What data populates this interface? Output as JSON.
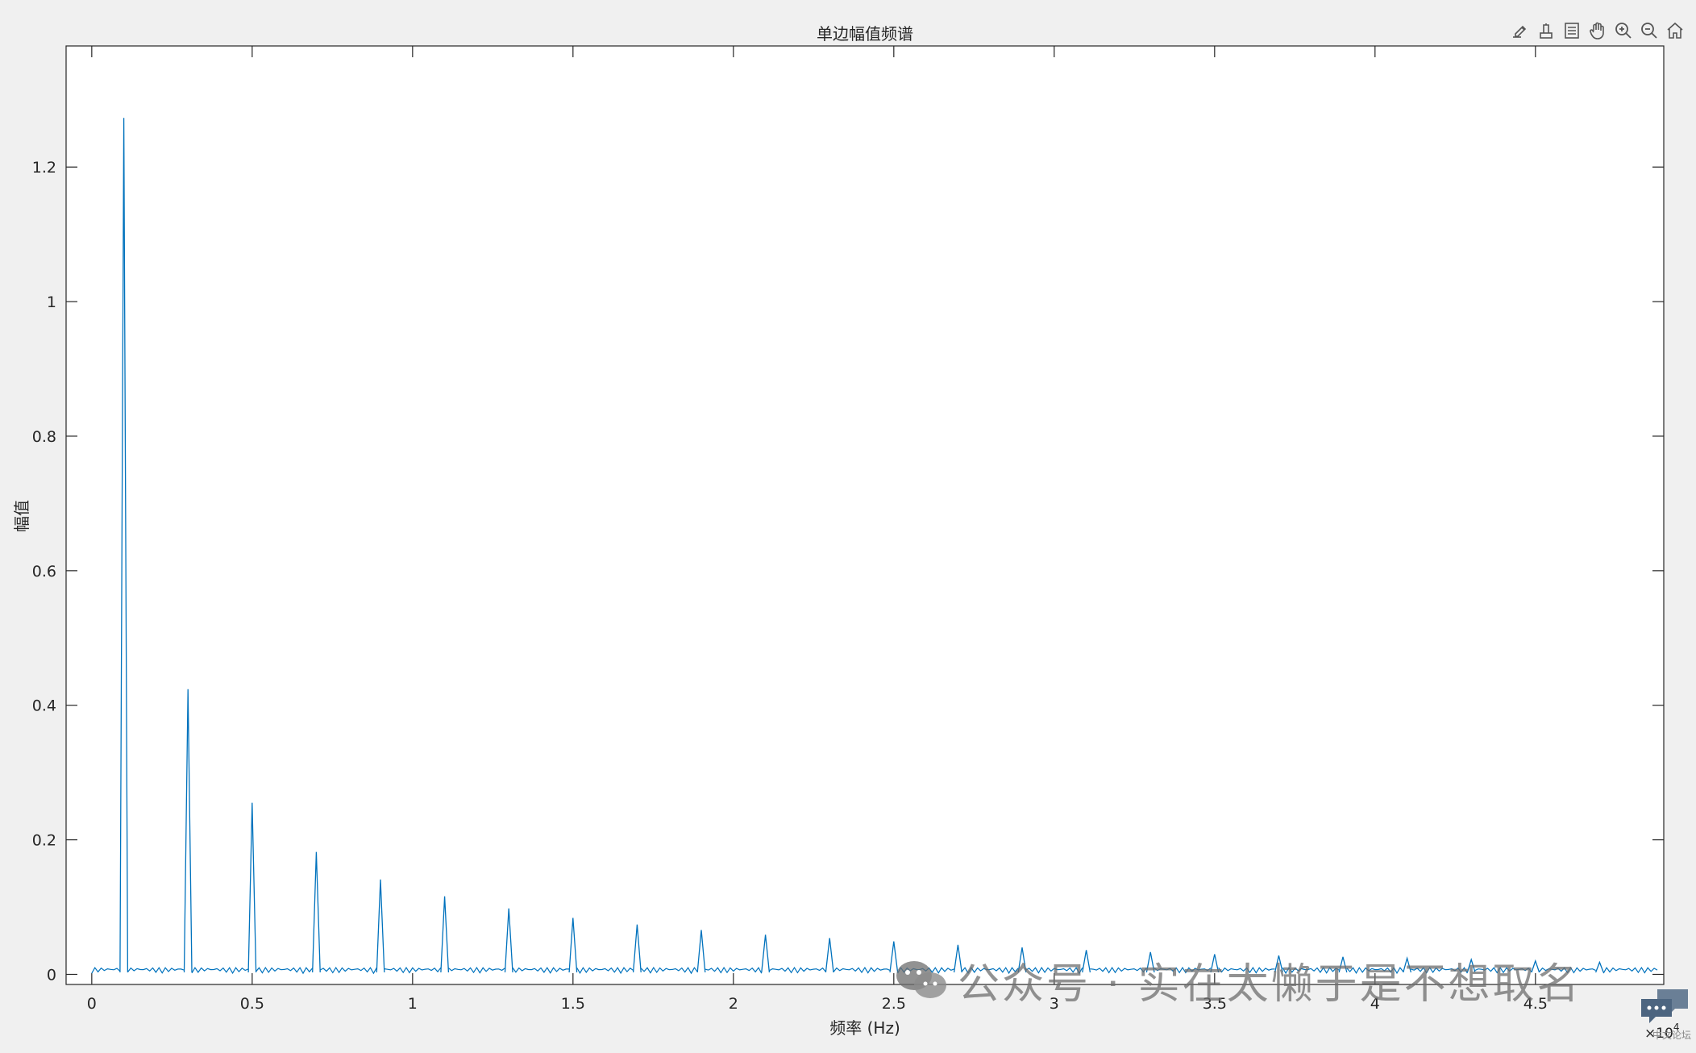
{
  "toolbar": {
    "icons": [
      "brush-edit-icon",
      "datatip-icon",
      "legend-icon",
      "pan-hand-icon",
      "zoom-in-icon",
      "zoom-out-icon",
      "home-icon"
    ]
  },
  "watermark": {
    "text": "公众号 · 实在太懒于是不想取名",
    "icon": "wechat-icon"
  },
  "corner_badge": {
    "text": "中文论坛",
    "icon": "chat-bubble-icon"
  },
  "colors": {
    "line": "#0072BD",
    "axes_bg": "#ffffff",
    "figure_bg": "#f0f0f0",
    "axis": "#262626"
  },
  "chart_data": {
    "type": "line",
    "title": "单边幅值频谱",
    "xlabel": "频率 (Hz)",
    "ylabel": "幅值",
    "x_exponent_label": "×10",
    "x_exponent_power": "4",
    "xlim": [
      -800,
      49000
    ],
    "ylim": [
      -0.015,
      1.38
    ],
    "x_ticks": [
      0,
      5000,
      10000,
      15000,
      20000,
      25000,
      30000,
      35000,
      40000,
      45000
    ],
    "x_tick_labels": [
      "0",
      "0.5",
      "1",
      "1.5",
      "2",
      "2.5",
      "3",
      "3.5",
      "4",
      "4.5"
    ],
    "y_ticks": [
      0,
      0.2,
      0.4,
      0.6,
      0.8,
      1.0,
      1.2
    ],
    "y_tick_labels": [
      "0",
      "0.2",
      "0.4",
      "0.6",
      "0.8",
      "1",
      "1.2"
    ],
    "grid": false,
    "series": [
      {
        "harmonic_frequencies": [
          1000,
          3000,
          5000,
          7000,
          9000,
          11000,
          13000,
          15000,
          17000,
          19000,
          21000,
          23000,
          25000,
          27000,
          29000,
          31000,
          33000,
          35000,
          37000,
          39000,
          41000,
          43000,
          45000,
          47000
        ],
        "harmonic_peaks": [
          1.273,
          0.424,
          0.255,
          0.182,
          0.141,
          0.116,
          0.098,
          0.084,
          0.074,
          0.066,
          0.059,
          0.054,
          0.049,
          0.044,
          0.04,
          0.036,
          0.033,
          0.03,
          0.028,
          0.026,
          0.024,
          0.022,
          0.02,
          0.018
        ],
        "noise_floor": 0.01
      }
    ]
  }
}
